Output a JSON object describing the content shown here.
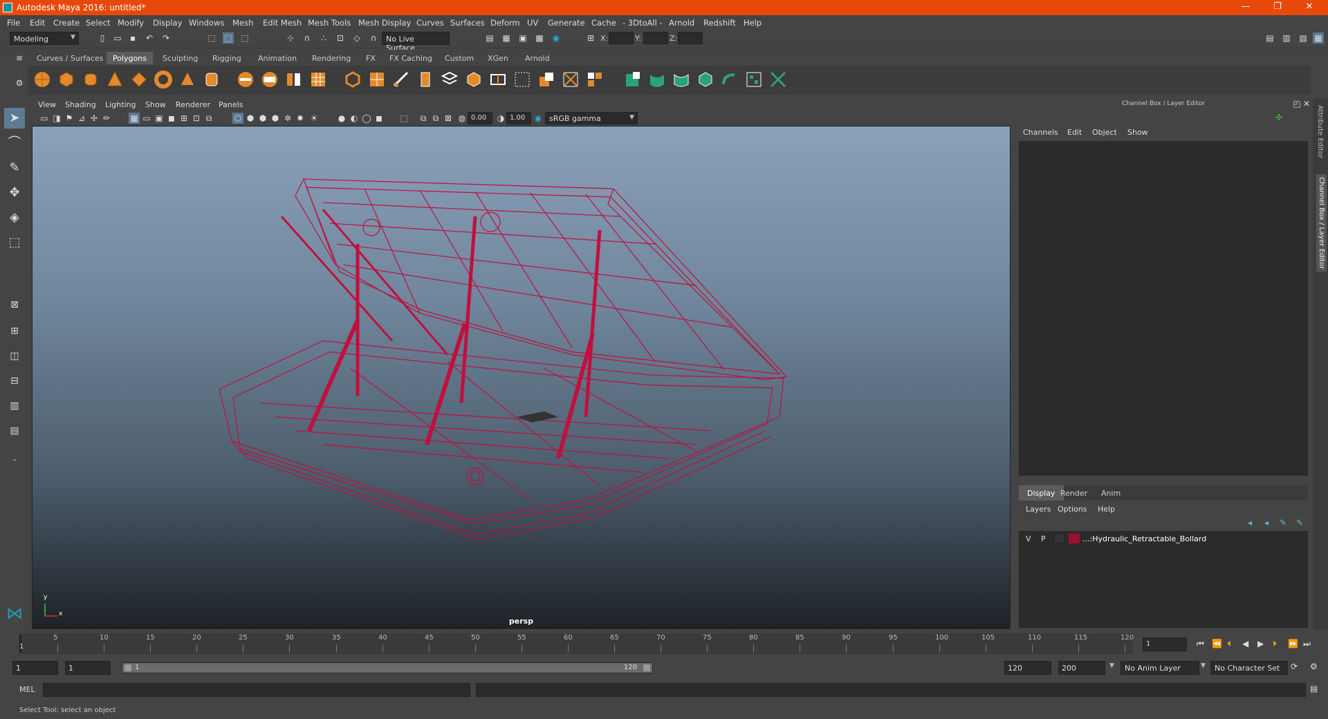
{
  "window": {
    "title": "Autodesk Maya 2016: untitled*",
    "controls": [
      "—",
      "❐",
      "✕"
    ]
  },
  "menubar": [
    "File",
    "Edit",
    "Create",
    "Select",
    "Modify",
    "Display",
    "Windows",
    "Mesh",
    "Edit Mesh",
    "Mesh Tools",
    "Mesh Display",
    "Curves",
    "Surfaces",
    "Deform",
    "UV",
    "Generate",
    "Cache",
    "- 3DtoAll -",
    "Arnold",
    "Redshift",
    "Help"
  ],
  "statusline": {
    "menuset": "Modeling",
    "live_surface": "No Live Surface",
    "x_label": "X:",
    "y_label": "Y:",
    "z_label": "Z:"
  },
  "shelf_tabs": [
    "Curves / Surfaces",
    "Polygons",
    "Sculpting",
    "Rigging",
    "Animation",
    "Rendering",
    "FX",
    "FX Caching",
    "Custom",
    "XGen",
    "Arnold"
  ],
  "shelf_active": "Polygons",
  "panel_menu": [
    "View",
    "Shading",
    "Lighting",
    "Show",
    "Renderer",
    "Panels"
  ],
  "panel_toolbar": {
    "exposure": "0.00",
    "gamma": "1.00",
    "color_space": "sRGB gamma"
  },
  "viewport": {
    "camera": "persp",
    "axis_y": "y",
    "axis_x": "x",
    "wire_color": "#c0103f"
  },
  "channel_box": {
    "header": "Channel Box / Layer Editor",
    "menu": [
      "Channels",
      "Edit",
      "Object",
      "Show"
    ]
  },
  "layer_editor": {
    "tabs": [
      "Display",
      "Render",
      "Anim"
    ],
    "active_tab": "Display",
    "menu": [
      "Layers",
      "Options",
      "Help"
    ],
    "layers": [
      {
        "v": "V",
        "p": "P",
        "color": "#a0102e",
        "name": "...:Hydraulic_Retractable_Bollard"
      }
    ]
  },
  "side_tabs": [
    "Attribute Editor",
    "Channel Box / Layer Editor"
  ],
  "timeline": {
    "ticks": [
      "5",
      "10",
      "15",
      "20",
      "25",
      "30",
      "35",
      "40",
      "45",
      "50",
      "55",
      "60",
      "65",
      "70",
      "75",
      "80",
      "85",
      "90",
      "95",
      "100",
      "105",
      "110",
      "115",
      "120"
    ],
    "start_marker": "1",
    "current_frame": "1"
  },
  "range": {
    "start": "1",
    "playback_start": "1",
    "slider_start": "1",
    "slider_end": "120",
    "playback_end": "120",
    "end": "200",
    "anim_layer": "No Anim Layer",
    "character_set": "No Character Set"
  },
  "command_line": {
    "label": "MEL"
  },
  "help_line": "Select Tool: select an object"
}
